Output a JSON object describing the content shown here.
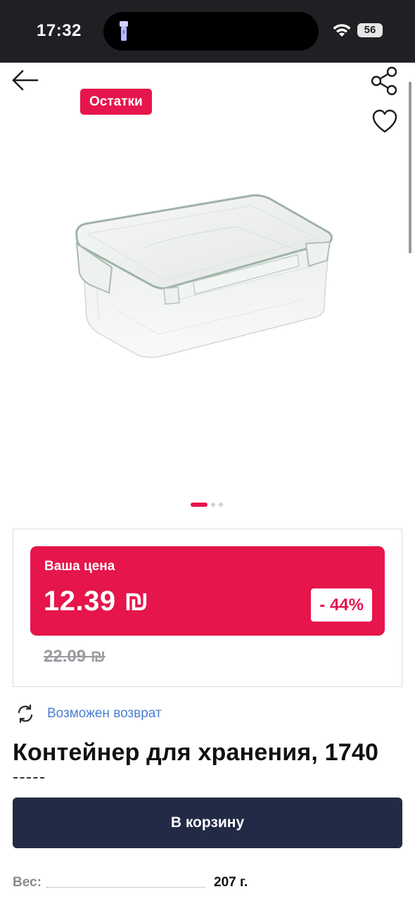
{
  "status_bar": {
    "time": "17:32",
    "battery": "56"
  },
  "header": {
    "badge": "Остатки"
  },
  "icons": {
    "back": "arrow-left-icon",
    "share": "share-icon",
    "favorite": "heart-icon",
    "return": "refresh-icon"
  },
  "carousel": {
    "total": 3,
    "active": 1
  },
  "price": {
    "label": "Ваша цена",
    "current": "12.39 ₪",
    "discount": "- 44%",
    "old": "22.09 ₪"
  },
  "return": {
    "text": "Возможен возврат"
  },
  "product": {
    "title": "Контейнер для хранения, 1740"
  },
  "actions": {
    "cart": "В корзину"
  },
  "specs": [
    {
      "label": "Вес:",
      "value": "207 г."
    }
  ],
  "colors": {
    "accent": "#e6154b",
    "button": "#222a45",
    "link": "#4a7fd0"
  }
}
